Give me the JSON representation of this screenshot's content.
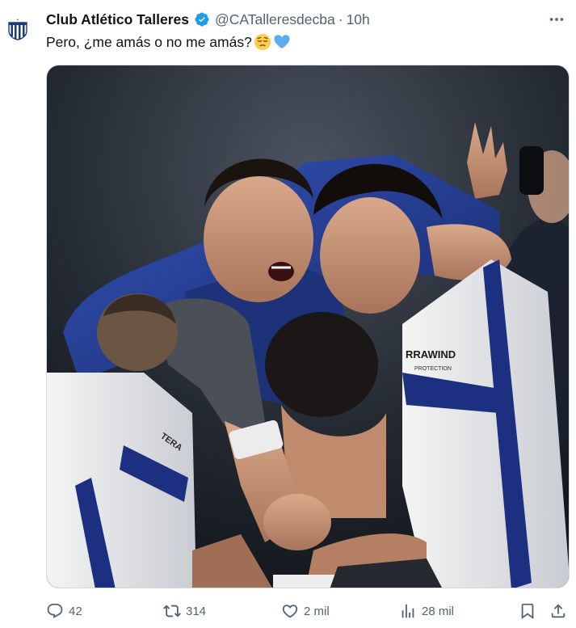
{
  "tweet": {
    "display_name": "Club Atlético Talleres",
    "handle": "@CATalleresdecba",
    "separator": "·",
    "time": "10h",
    "text": "Pero, ¿me amás o no me amás?",
    "emojis": [
      "pensive-face",
      "light-blue-heart"
    ],
    "verified": true,
    "media": {
      "kit_text_1": "RRAWIND",
      "kit_text_2": "PROTECTION",
      "kit_text_3": "TERA"
    }
  },
  "actions": {
    "replies": "42",
    "reposts": "314",
    "likes": "2 mil",
    "views": "28 mil"
  },
  "icons": {
    "more": "more-horizontal-icon",
    "reply": "reply-icon",
    "repost": "repost-icon",
    "like": "heart-icon",
    "views": "analytics-icon",
    "bookmark": "bookmark-icon",
    "share": "share-icon"
  },
  "colors": {
    "verified": "#1d9bf0",
    "secondary_text": "#536471",
    "primary_text": "#0f1419"
  }
}
